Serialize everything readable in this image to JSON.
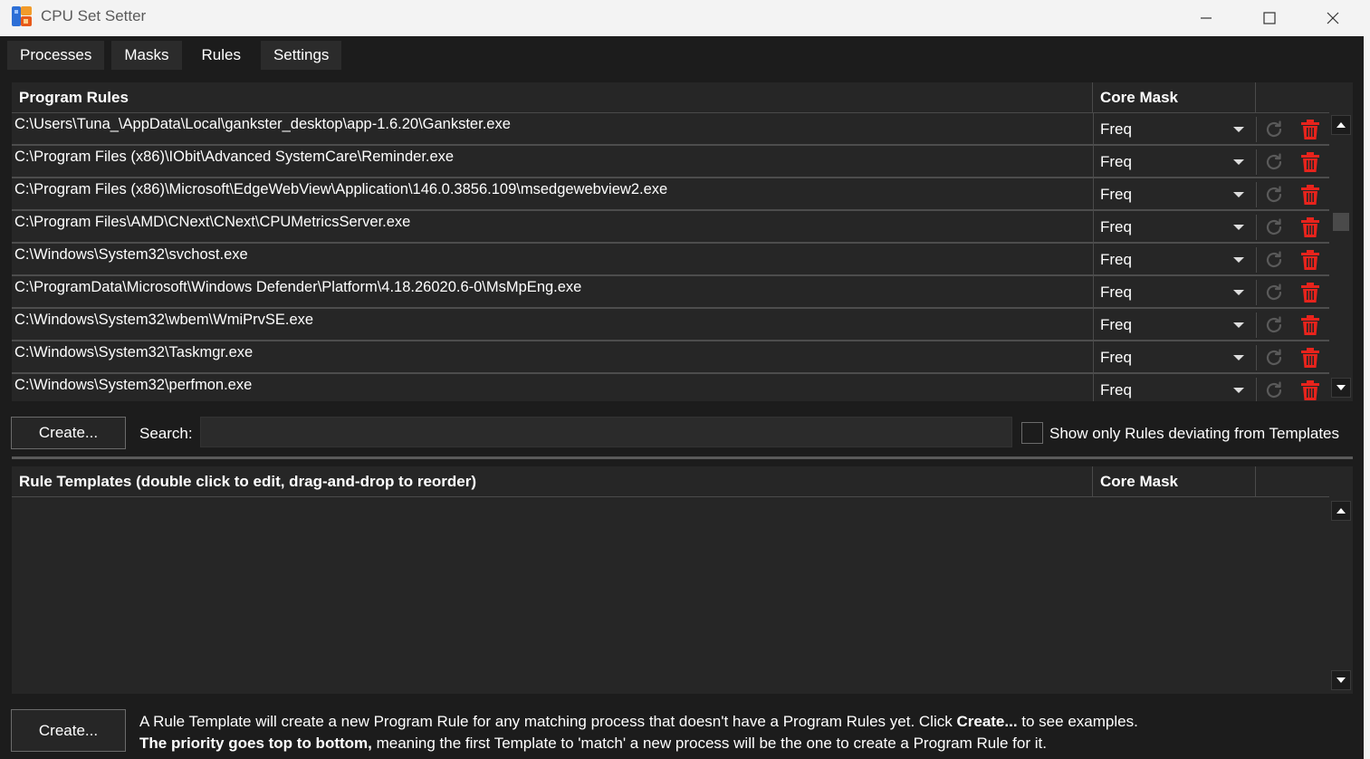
{
  "window": {
    "title": "CPU Set Setter"
  },
  "tabs": [
    {
      "label": "Processes"
    },
    {
      "label": "Masks"
    },
    {
      "label": "Rules"
    },
    {
      "label": "Settings"
    }
  ],
  "program_rules": {
    "header": "Program Rules",
    "core_mask_header": "Core Mask",
    "rows": [
      {
        "path": "C:\\Users\\Tuna_\\AppData\\Local\\gankster_desktop\\app-1.6.20\\Gankster.exe",
        "mask": "Freq"
      },
      {
        "path": "C:\\Program Files (x86)\\IObit\\Advanced SystemCare\\Reminder.exe",
        "mask": "Freq"
      },
      {
        "path": "C:\\Program Files (x86)\\Microsoft\\EdgeWebView\\Application\\146.0.3856.109\\msedgewebview2.exe",
        "mask": "Freq"
      },
      {
        "path": "C:\\Program Files\\AMD\\CNext\\CNext\\CPUMetricsServer.exe",
        "mask": "Freq"
      },
      {
        "path": "C:\\Windows\\System32\\svchost.exe",
        "mask": "Freq"
      },
      {
        "path": "C:\\ProgramData\\Microsoft\\Windows Defender\\Platform\\4.18.26020.6-0\\MsMpEng.exe",
        "mask": "Freq"
      },
      {
        "path": "C:\\Windows\\System32\\wbem\\WmiPrvSE.exe",
        "mask": "Freq"
      },
      {
        "path": "C:\\Windows\\System32\\Taskmgr.exe",
        "mask": "Freq"
      },
      {
        "path": "C:\\Windows\\System32\\perfmon.exe",
        "mask": "Freq"
      }
    ]
  },
  "controls": {
    "create_label": "Create...",
    "search_label": "Search:",
    "search_value": "",
    "deviating_label": "Show only Rules deviating from Templates",
    "deviating_checked": false
  },
  "templates": {
    "header": "Rule Templates (double click to edit, drag-and-drop to reorder)",
    "core_mask_header": "Core Mask",
    "create_label": "Create...",
    "info_line1_a": "A Rule Template will create a new Program Rule for any matching process that doesn't have a Program Rules yet. Click ",
    "info_line1_b": "Create...",
    "info_line1_c": " to see examples.",
    "info_line2_a": "The priority goes top to bottom,",
    "info_line2_b": " meaning the first Template to 'match' a new process will be the one to create a Program Rule for it."
  },
  "icons": {
    "app": "cpu-set-setter-app-icon",
    "minimize": "minimize-icon",
    "maximize": "maximize-icon",
    "close": "close-icon",
    "reset": "reset-icon",
    "delete": "trash-icon"
  },
  "colors": {
    "window_bg": "#1c1c1c",
    "panel_bg": "#262626",
    "delete_red": "#e8231c",
    "reset_gray": "#5a5a5a"
  }
}
